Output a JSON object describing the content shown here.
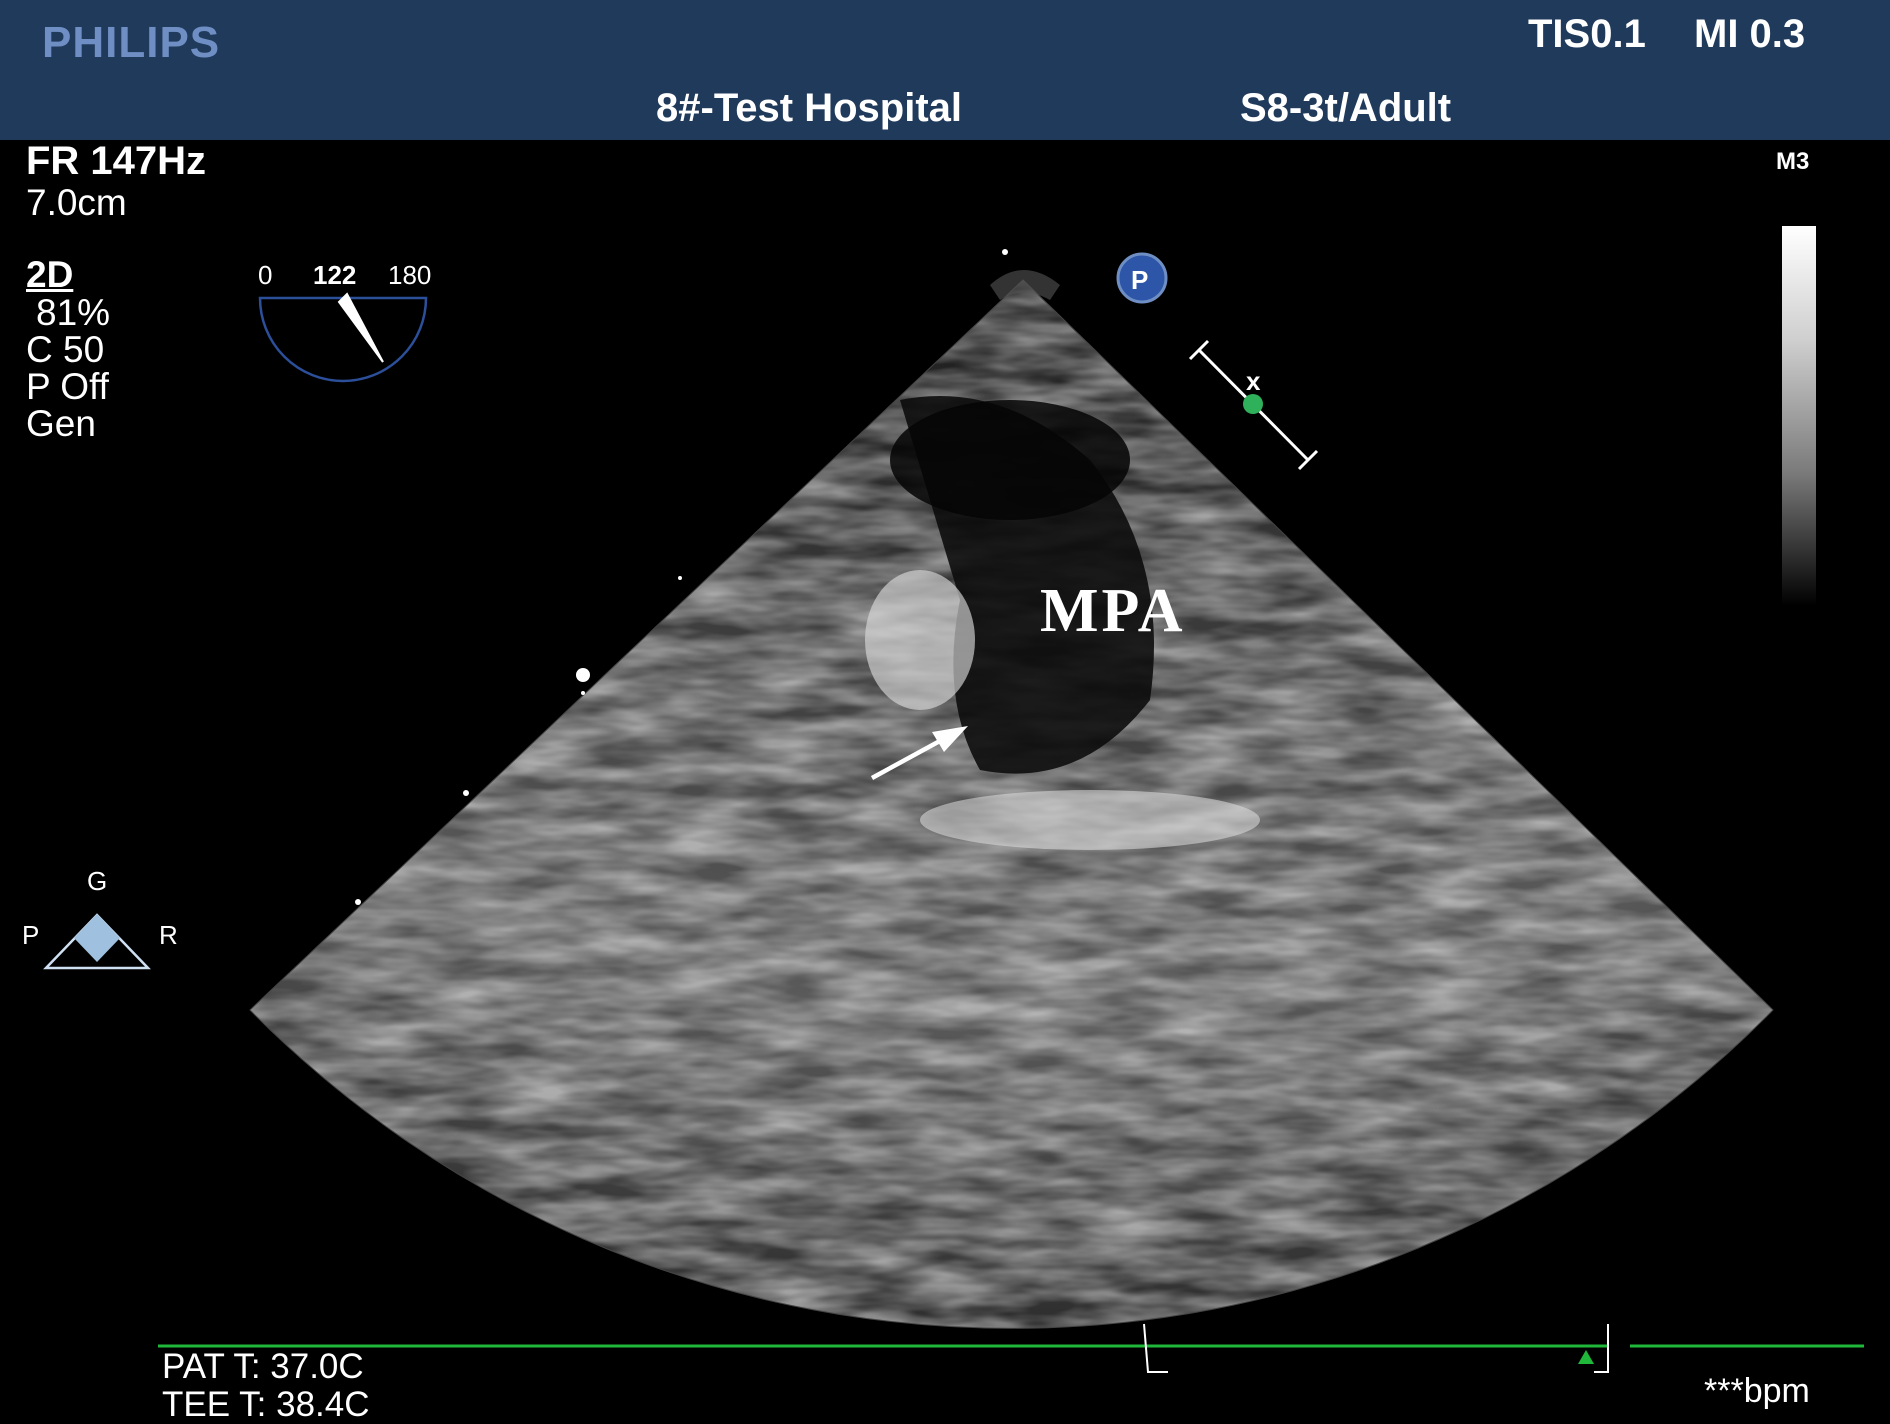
{
  "header": {
    "brand": "PHILIPS",
    "tis": "TIS0.1",
    "mi": "MI 0.3",
    "hospital": "8#-Test Hospital",
    "probe": "S8-3t/Adult"
  },
  "left_panel": {
    "frame_rate": "FR 147Hz",
    "depth": "7.0cm",
    "mode": "2D",
    "gain": "81%",
    "compression": "C 50",
    "persistence": "P Off",
    "preset": "Gen"
  },
  "angle_indicator": {
    "min_label": "0",
    "angle_label": "122",
    "max_label": "180",
    "angle_value": 122
  },
  "orientation": {
    "top_label": "G",
    "left_label": "P",
    "right_label": "R"
  },
  "right_panel": {
    "map_label": "M3",
    "focus_marker": "P"
  },
  "annotation": {
    "label": "MPA"
  },
  "footer": {
    "pat_temp": "PAT T: 37.0C",
    "tee_temp": "TEE T: 38.4C",
    "heart_rate": "***bpm"
  },
  "colors": {
    "header_bg": "#203a5c",
    "brand": "#6f8fc4",
    "ecg_line": "#1fb83a",
    "focus_marker": "#2d55a8"
  }
}
